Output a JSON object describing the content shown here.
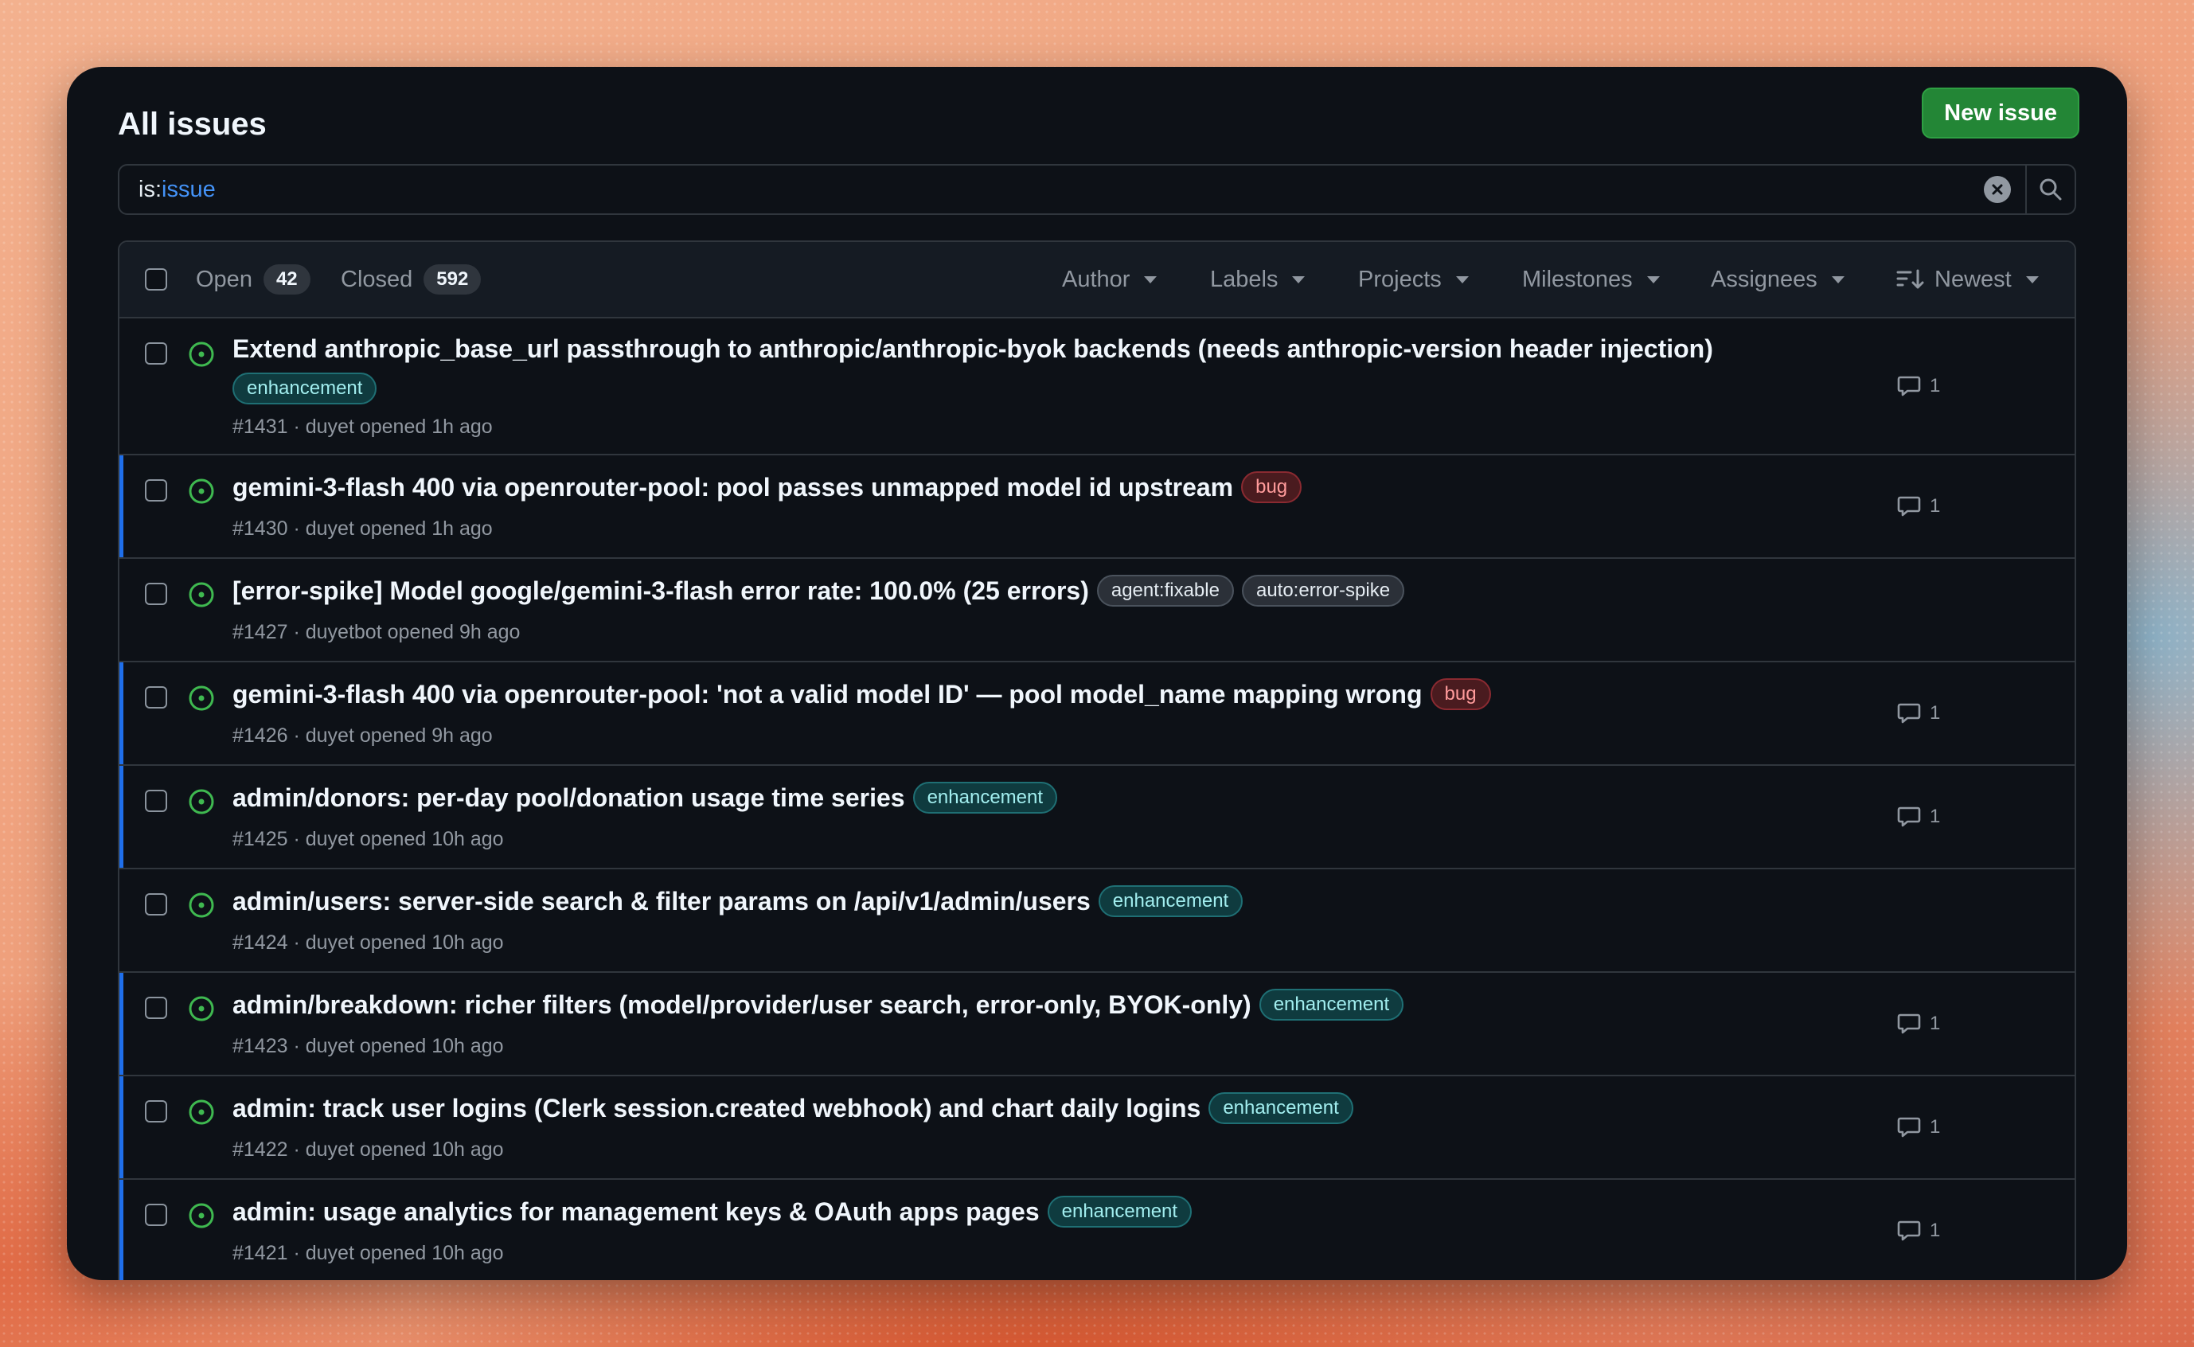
{
  "header": {
    "title": "All issues",
    "new_issue_label": "New issue"
  },
  "search": {
    "prefix": "is:",
    "term": "issue"
  },
  "tabs": {
    "open": {
      "label": "Open",
      "count": "42"
    },
    "closed": {
      "label": "Closed",
      "count": "592"
    }
  },
  "filters": {
    "author": "Author",
    "labels": "Labels",
    "projects": "Projects",
    "milestones": "Milestones",
    "assignees": "Assignees",
    "sort": "Newest"
  },
  "colors": {
    "accent": "#1f6feb",
    "open": "#3fb950",
    "primary_button": "#238636"
  },
  "issues": [
    {
      "title": "Extend anthropic_base_url passthrough to anthropic/anthropic-byok backends (needs anthropic-version header injection)",
      "labels": [
        "enhancement"
      ],
      "meta": "#1431 · duyet opened 1h ago",
      "comments": "1"
    },
    {
      "title": "gemini-3-flash 400 via openrouter-pool: pool passes unmapped model id upstream",
      "labels": [
        "bug"
      ],
      "meta": "#1430 · duyet opened 1h ago",
      "comments": "1"
    },
    {
      "title": "[error-spike] Model google/gemini-3-flash error rate: 100.0% (25 errors)",
      "labels": [
        "agent:fixable",
        "auto:error-spike"
      ],
      "meta": "#1427 · duyetbot opened 9h ago",
      "comments": ""
    },
    {
      "title": "gemini-3-flash 400 via openrouter-pool: 'not a valid model ID' — pool model_name mapping wrong",
      "labels": [
        "bug"
      ],
      "meta": "#1426 · duyet opened 9h ago",
      "comments": "1"
    },
    {
      "title": "admin/donors: per-day pool/donation usage time series",
      "labels": [
        "enhancement"
      ],
      "meta": "#1425 · duyet opened 10h ago",
      "comments": "1"
    },
    {
      "title": "admin/users: server-side search & filter params on /api/v1/admin/users",
      "labels": [
        "enhancement"
      ],
      "meta": "#1424 · duyet opened 10h ago",
      "comments": ""
    },
    {
      "title": "admin/breakdown: richer filters (model/provider/user search, error-only, BYOK-only)",
      "labels": [
        "enhancement"
      ],
      "meta": "#1423 · duyet opened 10h ago",
      "comments": "1"
    },
    {
      "title": "admin: track user logins (Clerk session.created webhook) and chart daily logins",
      "labels": [
        "enhancement"
      ],
      "meta": "#1422 · duyet opened 10h ago",
      "comments": "1"
    },
    {
      "title": "admin: usage analytics for management keys & OAuth apps pages",
      "labels": [
        "enhancement"
      ],
      "meta": "#1421 · duyet opened 10h ago",
      "comments": "1"
    }
  ]
}
